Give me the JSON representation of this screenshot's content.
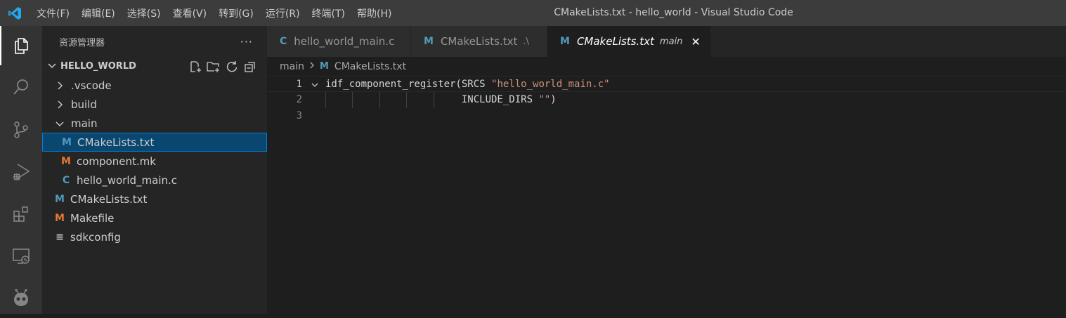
{
  "window": {
    "title": "CMakeLists.txt - hello_world - Visual Studio Code"
  },
  "menu": [
    "文件(F)",
    "编辑(E)",
    "选择(S)",
    "查看(V)",
    "转到(G)",
    "运行(R)",
    "终端(T)",
    "帮助(H)"
  ],
  "activity_bar": [
    "explorer-icon",
    "search-icon",
    "source-control-icon",
    "run-debug-icon",
    "extensions-icon",
    "remote-explorer-icon",
    "platformio-icon"
  ],
  "sidebar": {
    "title": "资源管理器",
    "more": "···",
    "folder": "HELLO_WORLD",
    "tree": [
      {
        "label": ".vscode",
        "type": "folder",
        "expanded": false,
        "depth": 1
      },
      {
        "label": "build",
        "type": "folder",
        "expanded": false,
        "depth": 1
      },
      {
        "label": "main",
        "type": "folder",
        "expanded": true,
        "depth": 1
      },
      {
        "label": "CMakeLists.txt",
        "type": "cmake",
        "icon": "M",
        "depth": 2,
        "selected": true
      },
      {
        "label": "component.mk",
        "type": "make",
        "icon": "M",
        "depth": 2
      },
      {
        "label": "hello_world_main.c",
        "type": "c",
        "icon": "C",
        "depth": 2
      },
      {
        "label": "CMakeLists.txt",
        "type": "cmake",
        "icon": "M",
        "depth": 1
      },
      {
        "label": "Makefile",
        "type": "make",
        "icon": "M",
        "depth": 1
      },
      {
        "label": "sdkconfig",
        "type": "text",
        "icon": "≡",
        "depth": 1
      }
    ]
  },
  "tabs": [
    {
      "label": "hello_world_main.c",
      "icon": "C",
      "description": "",
      "active": false
    },
    {
      "label": "CMakeLists.txt",
      "icon": "M",
      "description": ".\\",
      "active": false
    },
    {
      "label": "CMakeLists.txt",
      "icon": "M",
      "description": "main",
      "active": true,
      "close": "✕"
    }
  ],
  "breadcrumb": {
    "folder": "main",
    "icon": "M",
    "file": "CMakeLists.txt"
  },
  "editor": {
    "lines": [
      {
        "number": "1",
        "code_a": "idf_component_register(SRCS ",
        "string": "\"hello_world_main.c\"",
        "code_b": ""
      },
      {
        "number": "2",
        "code_a": "                       INCLUDE_DIRS ",
        "string": "\"\"",
        "code_b": ")"
      },
      {
        "number": "3",
        "code_a": "",
        "string": "",
        "code_b": ""
      }
    ]
  },
  "colors": {
    "cmake_icon": "#519aba",
    "make_icon": "#e37933",
    "selection": "#094771",
    "string": "#ce9178",
    "vscode_blue": "#23a9f2"
  }
}
